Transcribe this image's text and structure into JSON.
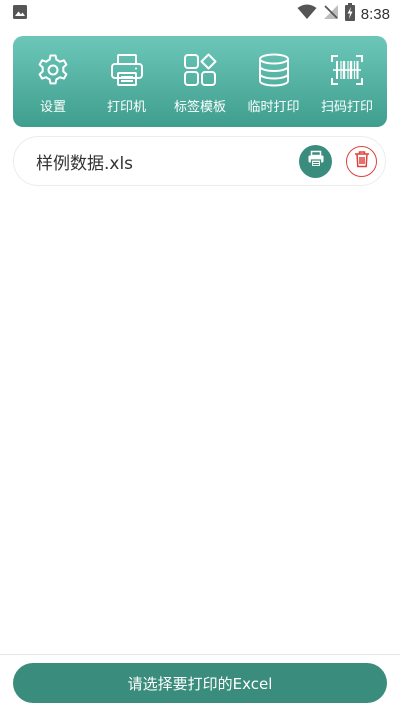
{
  "status_bar": {
    "time": "8:38",
    "icons": [
      "image-notification-icon",
      "wifi-icon",
      "no-signal-icon",
      "battery-charging-icon"
    ]
  },
  "toolbar": {
    "items": [
      {
        "label": "设置",
        "icon": "gear-icon"
      },
      {
        "label": "打印机",
        "icon": "printer-icon"
      },
      {
        "label": "标签模板",
        "icon": "template-grid-icon"
      },
      {
        "label": "临时打印",
        "icon": "database-icon"
      },
      {
        "label": "扫码打印",
        "icon": "barcode-scan-icon"
      }
    ]
  },
  "files": [
    {
      "name": "样例数据.xls"
    }
  ],
  "bottom": {
    "button_label": "请选择要打印的Excel"
  },
  "colors": {
    "accent": "#3a8c7d",
    "toolbar_top": "#6cc7b9",
    "toolbar_bottom": "#3f9e8e",
    "delete": "#e0413a"
  }
}
